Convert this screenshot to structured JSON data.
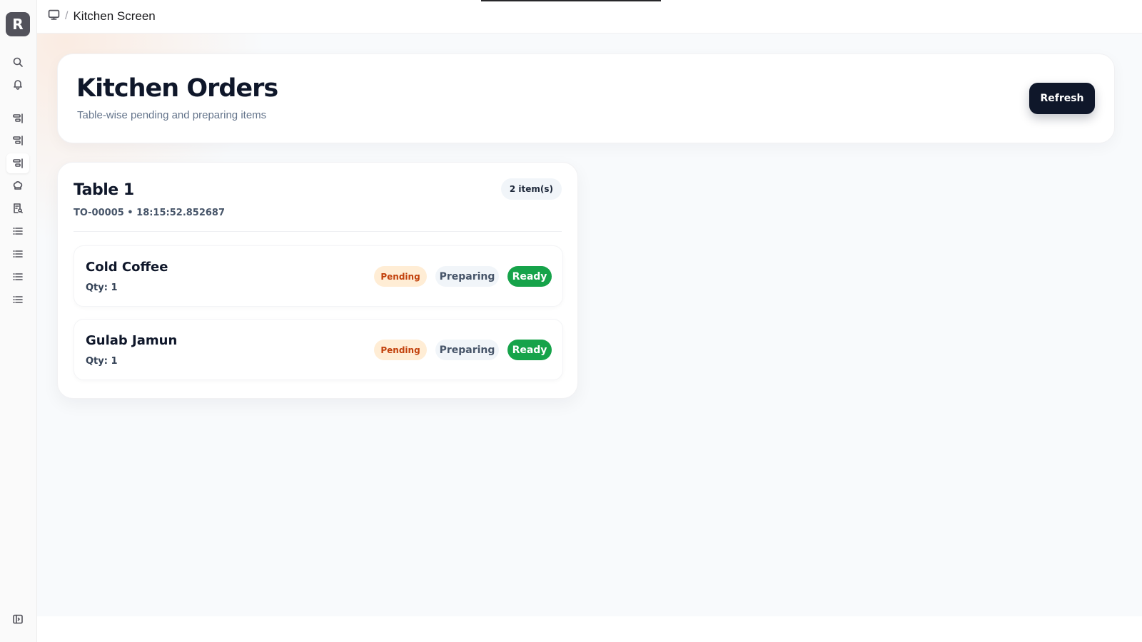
{
  "app": {
    "logo_letter": "R"
  },
  "breadcrumb": {
    "title": "Kitchen Screen"
  },
  "header": {
    "title": "Kitchen Orders",
    "subtitle": "Table-wise pending and preparing items",
    "refresh_label": "Refresh"
  },
  "table_card": {
    "title": "Table 1",
    "meta": "TO-00005 • 18:15:52.852687",
    "count_badge": "2 item(s)",
    "items": [
      {
        "name": "Cold Coffee",
        "qty": "Qty: 1",
        "pending": "Pending",
        "preparing": "Preparing",
        "ready": "Ready"
      },
      {
        "name": "Gulab Jamun",
        "qty": "Qty: 1",
        "pending": "Pending",
        "preparing": "Preparing",
        "ready": "Ready"
      }
    ]
  },
  "colors": {
    "primary": "#0f172a",
    "pending_bg": "#ffedd5",
    "pending_text": "#c2410c",
    "ready_bg": "#16a34a"
  }
}
